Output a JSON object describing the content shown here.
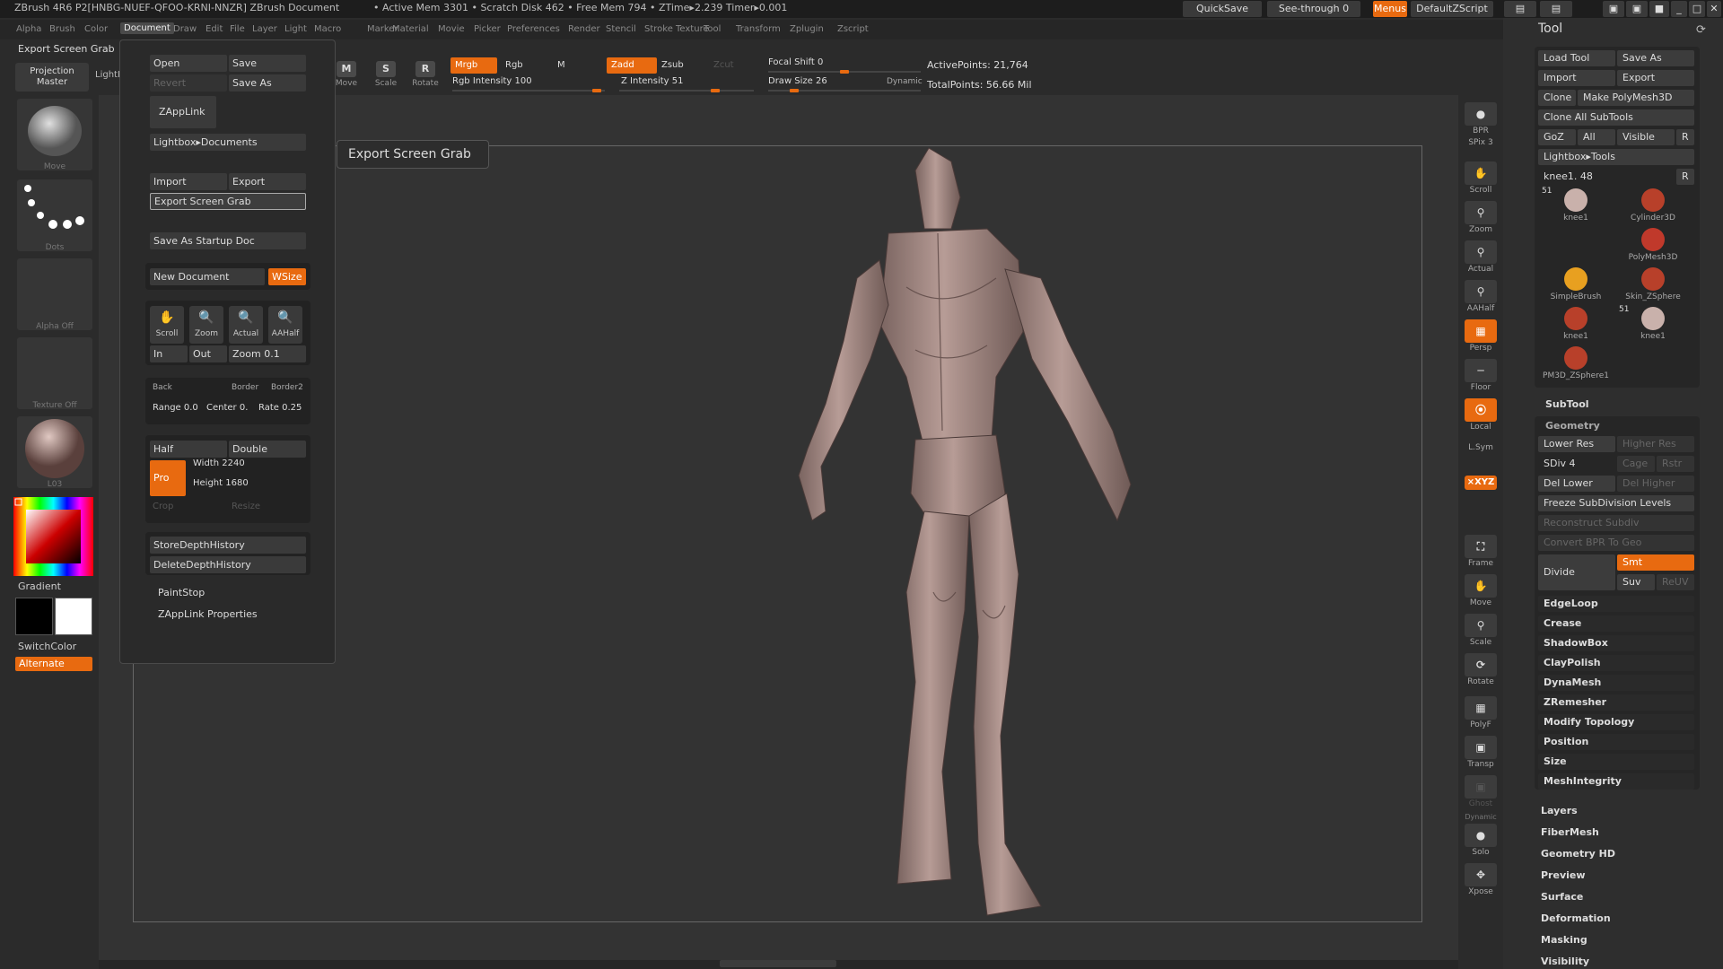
{
  "titlebar": {
    "title": "ZBrush 4R6 P2[HNBG-NUEF-QFOO-KRNI-NNZR]   ZBrush Document",
    "stats": "• Active Mem 3301  • Scratch Disk 462  • Free Mem 794  • ZTime▸2.239  Timer▸0.001",
    "quicksave": "QuickSave",
    "seethrough": "See-through  0",
    "menus": "Menus",
    "defaultzscript": "DefaultZScript"
  },
  "menubar": [
    "Alpha",
    "Brush",
    "Color",
    "Document",
    "Draw",
    "Edit",
    "File",
    "Layer",
    "Light",
    "Macro",
    "Marker",
    "Material",
    "Movie",
    "Picker",
    "Preferences",
    "Render",
    "Stencil",
    "Stroke",
    "Texture",
    "Tool",
    "Transform",
    "Zplugin",
    "Zscript"
  ],
  "menubar_selected": "Document",
  "shelf": {
    "export_label": "Export Screen Grab",
    "lightbox": "LightBox",
    "move": "Move",
    "scale": "Scale",
    "rotate": "Rotate",
    "mrgb": "Mrgb",
    "rgb": "Rgb",
    "m": "M",
    "zadd": "Zadd",
    "zsub": "Zsub",
    "zcut": "Zcut",
    "rgb_intensity": "Rgb Intensity 100",
    "z_intensity": "Z Intensity 51",
    "focal_shift": "Focal Shift 0",
    "draw_size": "Draw Size 26",
    "dynamic": "Dynamic",
    "active_points": "ActivePoints: 21,764",
    "total_points": "TotalPoints: 56.66 Mil"
  },
  "left": {
    "projection_master": "Projection Master",
    "brush_cap": "Move",
    "stroke_cap": "Dots",
    "alpha_cap": "Alpha Off",
    "texture_cap": "Texture Off",
    "material_cap": "L03",
    "gradient": "Gradient",
    "switchcolor": "SwitchColor",
    "alternate": "Alternate"
  },
  "popup": {
    "open": "Open",
    "save": "Save",
    "revert": "Revert",
    "save_as": "Save As",
    "zapplink": "ZAppLink",
    "lightbox_docs": "Lightbox▸Documents",
    "import": "Import",
    "export": "Export",
    "export_grab": "Export Screen Grab",
    "save_startup": "Save As Startup Doc",
    "new_doc": "New Document",
    "wsize": "WSize",
    "scroll": "Scroll",
    "zoom": "Zoom",
    "actual": "Actual",
    "aahalf": "AAHalf",
    "in": "In",
    "out": "Out",
    "zoom_val": "Zoom 0.1",
    "back": "Back",
    "border": "Border",
    "border2": "Border2",
    "range": "Range 0.0",
    "center": "Center 0.",
    "rate": "Rate 0.25",
    "half": "Half",
    "double": "Double",
    "pro": "Pro",
    "width": "Width 2240",
    "height": "Height 1680",
    "crop": "Crop",
    "resize": "Resize",
    "store_depth": "StoreDepthHistory",
    "delete_depth": "DeleteDepthHistory",
    "paintstop": "PaintStop",
    "zapplink_props": "ZAppLink Properties"
  },
  "tooltip": "Export Screen Grab",
  "rightshelf": {
    "bpr": "BPR",
    "spix": "SPix 3",
    "scroll": "Scroll",
    "zoom": "Zoom",
    "actual": "Actual",
    "aahalf": "AAHalf",
    "persp": "Persp",
    "floor": "Floor",
    "local": "Local",
    "lsym": "L.Sym",
    "xyz": "⨯XYZ",
    "frame": "Frame",
    "move": "Move",
    "scale": "Scale",
    "rotate": "Rotate",
    "polyf": "PolyF",
    "transp": "Transp",
    "ghost": "Ghost",
    "dynamic": "Dynamic",
    "solo": "Solo",
    "xpose": "Xpose"
  },
  "tool": {
    "title": "Tool",
    "load_tool": "Load Tool",
    "save_as": "Save As",
    "import": "Import",
    "export": "Export",
    "clone": "Clone",
    "make_polymesh": "Make PolyMesh3D",
    "clone_all": "Clone All SubTools",
    "goz": "GoZ",
    "all": "All",
    "visible": "Visible",
    "r": "R",
    "lightbox_tools": "Lightbox▸Tools",
    "current_tool": "knee1. 48",
    "r2": "R",
    "subtools": [
      {
        "name": "knee1",
        "count": "51"
      },
      {
        "name": "Cylinder3D"
      },
      {
        "name": "PolyMesh3D"
      },
      {
        "name": "SimpleBrush"
      },
      {
        "name": "Skin_ZSphere"
      },
      {
        "name": "knee1"
      },
      {
        "name": "knee1",
        "count": "51"
      },
      {
        "name": "PM3D_ZSphere1"
      }
    ],
    "subtool": "SubTool",
    "geometry": "Geometry",
    "lower_res": "Lower Res",
    "higher_res": "Higher Res",
    "sdiv": "SDiv 4",
    "cage": "Cage",
    "rstr": "Rstr",
    "del_lower": "Del Lower",
    "del_higher": "Del Higher",
    "freeze": "Freeze SubDivision Levels",
    "reconstruct": "Reconstruct Subdiv",
    "convert_bpr": "Convert BPR To Geo",
    "divide": "Divide",
    "smt": "Smt",
    "suv": "Suv",
    "reuv": "ReUV",
    "sections": [
      "EdgeLoop",
      "Crease",
      "ShadowBox",
      "ClayPolish",
      "DynaMesh",
      "ZRemesher",
      "Modify Topology",
      "Position",
      "Size",
      "MeshIntegrity"
    ],
    "outer_sections": [
      "Layers",
      "FiberMesh",
      "Geometry HD",
      "Preview",
      "Surface",
      "Deformation",
      "Masking",
      "Visibility"
    ]
  },
  "colors": {
    "accent": "#e86a10",
    "bg": "#2b2b2b",
    "model": "#a58a84"
  }
}
